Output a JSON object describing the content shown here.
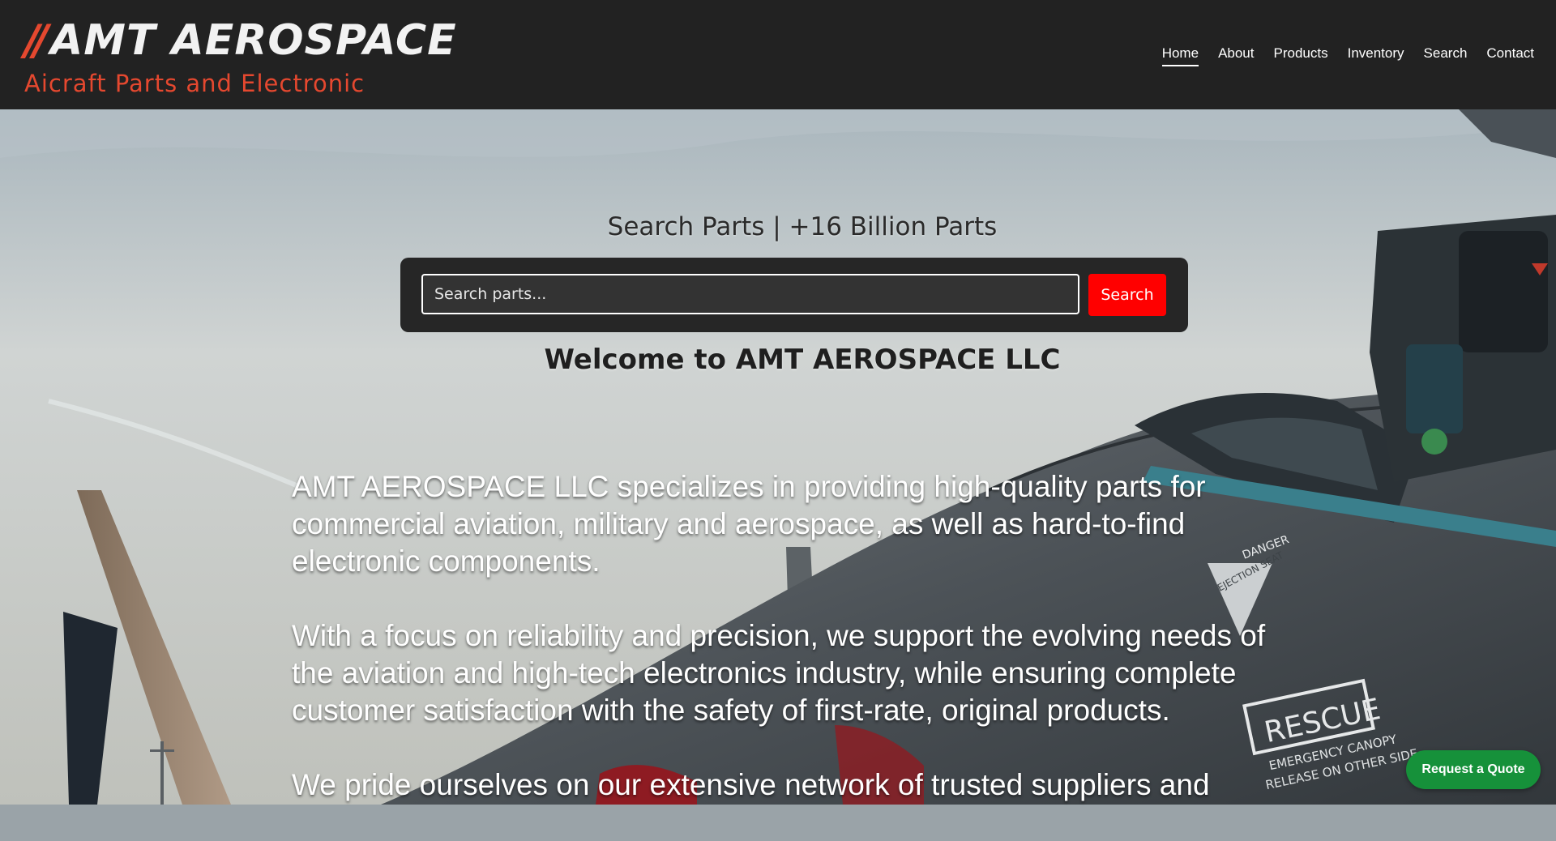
{
  "header": {
    "logo_mark": "//",
    "logo_name": "AMT AEROSPACE",
    "logo_tagline": "Aicraft Parts and Electronic",
    "nav": [
      {
        "label": "Home",
        "active": true
      },
      {
        "label": "About",
        "active": false
      },
      {
        "label": "Products",
        "active": false
      },
      {
        "label": "Inventory",
        "active": false
      },
      {
        "label": "Search",
        "active": false
      },
      {
        "label": "Contact",
        "active": false
      }
    ]
  },
  "hero": {
    "search_title": "Search Parts | +16 Billion Parts",
    "search_placeholder": "Search parts...",
    "search_button": "Search",
    "welcome": "Welcome to AMT AEROSPACE LLC",
    "paragraphs": [
      "AMT AEROSPACE LLC specializes in providing high-quality parts for commercial aviation, military and aerospace, as well as hard-to-find electronic components.",
      "With a focus on reliability and precision, we support the evolving needs of the aviation and high-tech electronics industry, while ensuring complete customer satisfaction with the safety of first-rate, original products.",
      "We pride ourselves on our extensive network of trusted suppliers and"
    ],
    "jet_markings": {
      "danger": "DANGER",
      "ejection_seat": "EJECTION SEAT",
      "rescue": "RESCUE",
      "canopy_line1": "EMERGENCY CANOPY",
      "canopy_line2": "RELEASE ON OTHER SIDE"
    }
  },
  "quote_button": "Request a Quote",
  "colors": {
    "header_bg": "#222222",
    "brand_accent": "#e5482f",
    "search_button": "#ff0000",
    "quote_button": "#16913a"
  }
}
